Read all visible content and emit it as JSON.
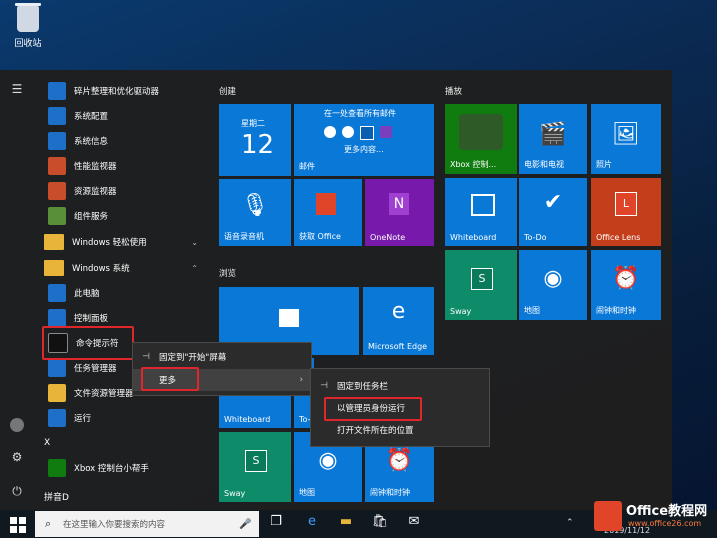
{
  "desktop": {
    "recycle_bin_label": "回收站"
  },
  "app_list": {
    "items": [
      {
        "label": "碎片整理和优化驱动器",
        "color": "#1e6fc8"
      },
      {
        "label": "系统配置",
        "color": "#1e6fc8"
      },
      {
        "label": "系统信息",
        "color": "#1e6fc8"
      },
      {
        "label": "性能监视器",
        "color": "#1e6fc8"
      },
      {
        "label": "资源监视器",
        "color": "#1e6fc8"
      },
      {
        "label": "组件服务",
        "color": "#1e6fc8"
      }
    ],
    "group_ease": "Windows 轻松使用",
    "group_system": "Windows 系统",
    "system_items": [
      {
        "label": "此电脑",
        "color": "#1e6fc8"
      },
      {
        "label": "控制面板",
        "color": "#1e6fc8"
      },
      {
        "label": "命令提示符",
        "color": "#111111"
      },
      {
        "label": "任务管理器",
        "color": "#1e6fc8"
      },
      {
        "label": "文件资源管理器",
        "color": "#e8b43a"
      },
      {
        "label": "运行",
        "color": "#1e6fc8"
      }
    ],
    "letter_x": "X",
    "xbox_label": "Xbox 控制台小帮手",
    "letter_pinyin": "拼音D"
  },
  "sections": {
    "create": "创建",
    "browse": "浏览",
    "play": "播放"
  },
  "tiles": {
    "calendar_weekday": "星期二",
    "calendar_day": "12",
    "mail_header": "在一处查看所有邮件",
    "mail_more": "更多内容...",
    "mail": "邮件",
    "voice_recorder": "语音录音机",
    "get_office": "获取 Office",
    "onenote": "OneNote",
    "store": "",
    "edge": "Microsoft Edge",
    "whiteboard_browse": "Whiteboard",
    "browse_partial": "To-Do",
    "sway_browse": "Sway",
    "maps_browse": "地图",
    "alarms_browse": "闹钟和时钟",
    "xbox": "Xbox 控制...",
    "movies": "电影和电视",
    "photos": "照片",
    "whiteboard": "Whiteboard",
    "todo": "To-Do",
    "office_lens": "Office Lens",
    "sway": "Sway",
    "maps": "地图",
    "alarms": "闹钟和时钟"
  },
  "context_menu_1": {
    "pin_start": "固定到\"开始\"屏幕",
    "more": "更多"
  },
  "context_menu_2": {
    "pin_taskbar": "固定到任务栏",
    "run_admin": "以管理员身份运行",
    "open_location": "打开文件所在的位置"
  },
  "taskbar": {
    "search_placeholder": "在这里输入你要搜索的内容",
    "date": "2019/11/12"
  },
  "watermark": {
    "title": "Office教程网",
    "url": "www.office26.com"
  }
}
